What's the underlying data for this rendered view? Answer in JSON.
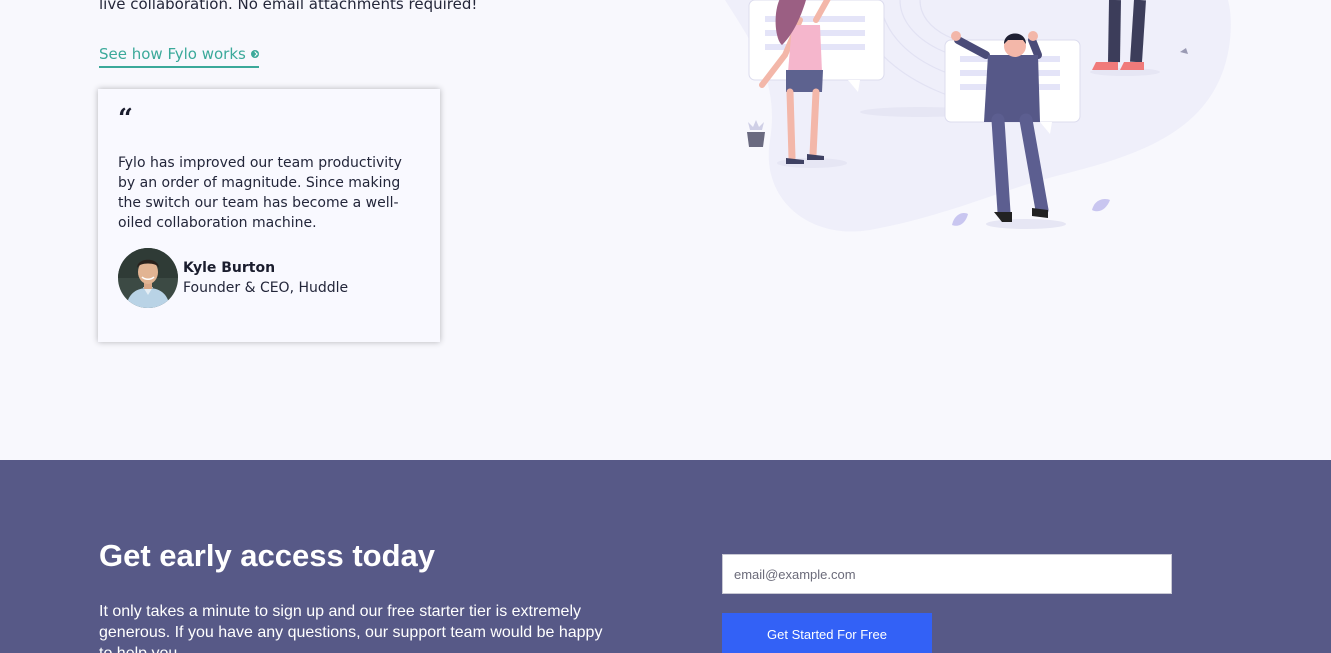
{
  "intro": {
    "tail_text": "live collaboration. No email attachments required!",
    "link_label": "See how Fylo works"
  },
  "testimonial": {
    "quote_mark": "“",
    "quote": "Fylo has improved our team productivity by an order of magnitude. Since making the switch our team has become a well-oiled collaboration machine.",
    "author_name": "Kyle Burton",
    "author_title": "Founder & CEO, Huddle"
  },
  "cta": {
    "title": "Get early access today",
    "text": "It only takes a minute to sign up and our free starter tier is extremely generous. If you have any questions, our support team would be happy to help you.",
    "email_placeholder": "email@example.com",
    "button_label": "Get Started For Free"
  },
  "colors": {
    "accent_link": "#3ba99a",
    "cta_background": "#575987",
    "button_blue": "#3361f6"
  }
}
